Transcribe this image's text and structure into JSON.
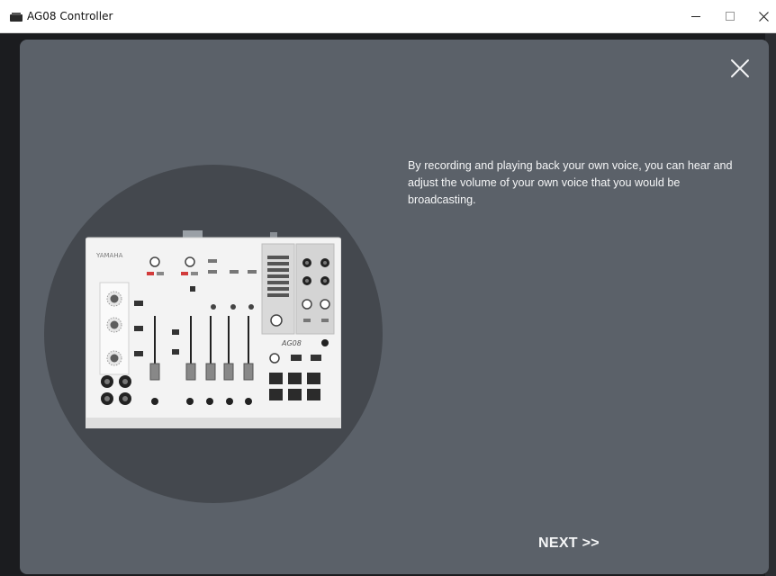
{
  "window": {
    "title": "AG08 Controller",
    "controls": {
      "minimize": "minimize-icon",
      "maximize": "maximize-icon",
      "close": "close-icon"
    }
  },
  "dialog": {
    "description": "By recording and playing back your own voice, you can hear and adjust the volume of your own voice that you would be broadcasting.",
    "next_label": "NEXT >>",
    "close_icon": "close-icon",
    "illustration": "mixer-illustration",
    "mixer_brand": "YAMAHA",
    "mixer_model": "AG08"
  },
  "colors": {
    "dialog_bg": "#5b6169",
    "circle_bg": "#44484e",
    "text": "#f5f6f7",
    "titlebar_bg": "#ffffff"
  }
}
